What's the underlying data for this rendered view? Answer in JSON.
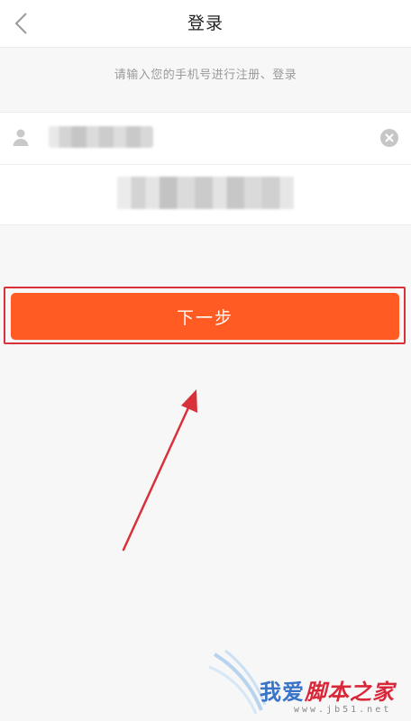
{
  "header": {
    "title": "登录",
    "back_icon": "chevron-left-icon"
  },
  "hint": {
    "text": "请输入您的手机号进行注册、登录"
  },
  "form": {
    "phone": {
      "icon": "user-icon",
      "value": "",
      "clear_icon": "clear-circle-icon"
    },
    "code": {
      "value": ""
    }
  },
  "next_button": {
    "label": "下一步",
    "color": "#ff5b23"
  },
  "annotation": {
    "highlight_color": "#d8313a",
    "arrow_color": "#d8313a"
  },
  "watermark": {
    "part1": "我爱",
    "part2": "脚本之家",
    "url": "www.jb51.net"
  }
}
